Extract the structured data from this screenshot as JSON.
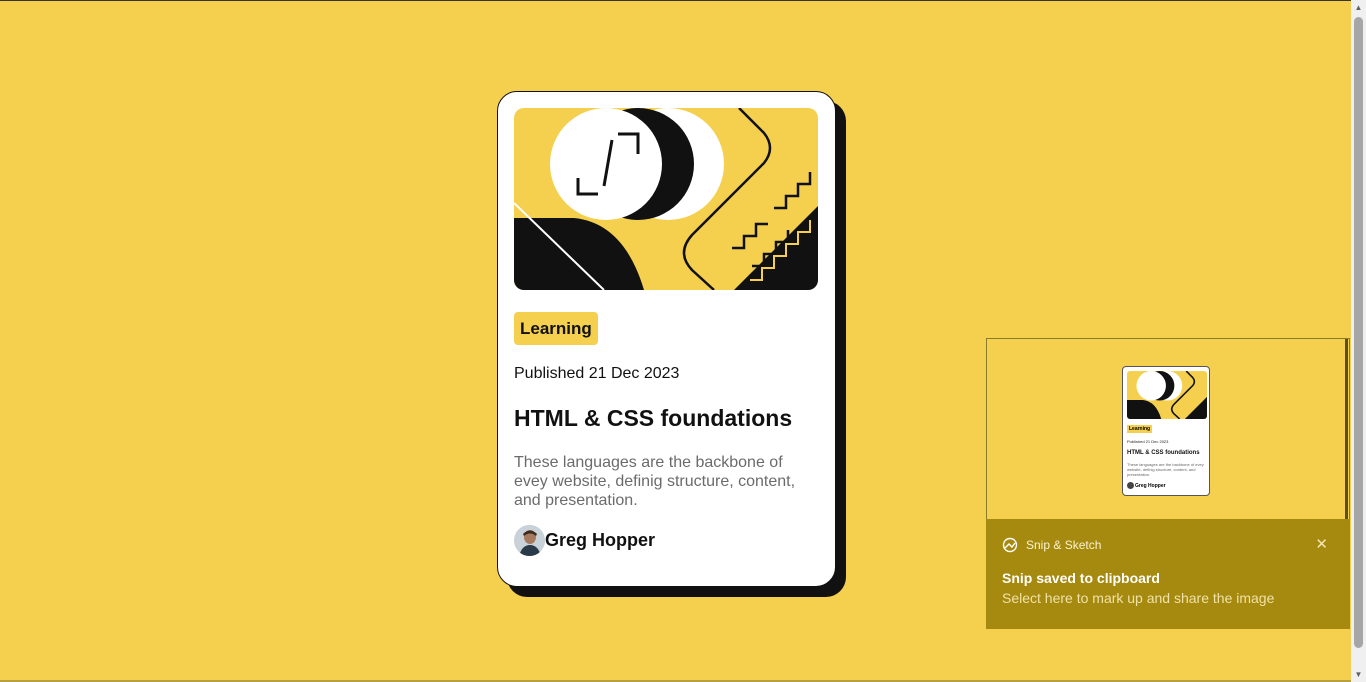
{
  "colors": {
    "background": "#f4d04e",
    "card": "#ffffff",
    "card_border": "#111111",
    "tag_bg": "#f4d04e",
    "text_muted": "#6b6b6b",
    "notification_bg": "#a6890f"
  },
  "card": {
    "tag": "Learning",
    "published": "Published 21 Dec 2023",
    "title": "HTML & CSS foundations",
    "description": "These languages are the backbone of evey website, definig structure, content, and presentation.",
    "author": "Greg Hopper",
    "illustration_icon": "illustration-article"
  },
  "notification": {
    "app_name": "Snip & Sketch",
    "app_icon": "snip-sketch-icon",
    "close_icon": "close-icon",
    "title": "Snip saved to clipboard",
    "message": "Select here to mark up and share the image",
    "preview": {
      "tag": "Learning",
      "published": "Published 21 Dec 2023",
      "title": "HTML & CSS foundations",
      "description": "These languages are the backbone of evey website, definig structure, content, and presentation.",
      "author": "Greg Hopper"
    }
  },
  "scrollbar": {
    "up_icon": "arrow-up-icon",
    "down_icon": "arrow-down-icon"
  }
}
